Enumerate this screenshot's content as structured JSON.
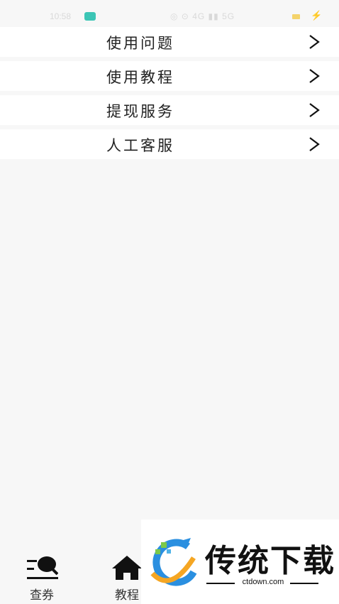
{
  "status_bar": {
    "time": "10:58",
    "right_text": "◎ ⊙ 4G ▮▮ 5G"
  },
  "menu": {
    "items": [
      {
        "label": "使用问题"
      },
      {
        "label": "使用教程"
      },
      {
        "label": "提现服务"
      },
      {
        "label": "人工客服"
      }
    ]
  },
  "tabbar": {
    "tabs": [
      {
        "label": "查券",
        "icon": "search-list-icon"
      },
      {
        "label": "教程",
        "icon": "home-icon"
      }
    ]
  },
  "watermark": {
    "title": "传统下载",
    "url": "ctdown.com"
  }
}
